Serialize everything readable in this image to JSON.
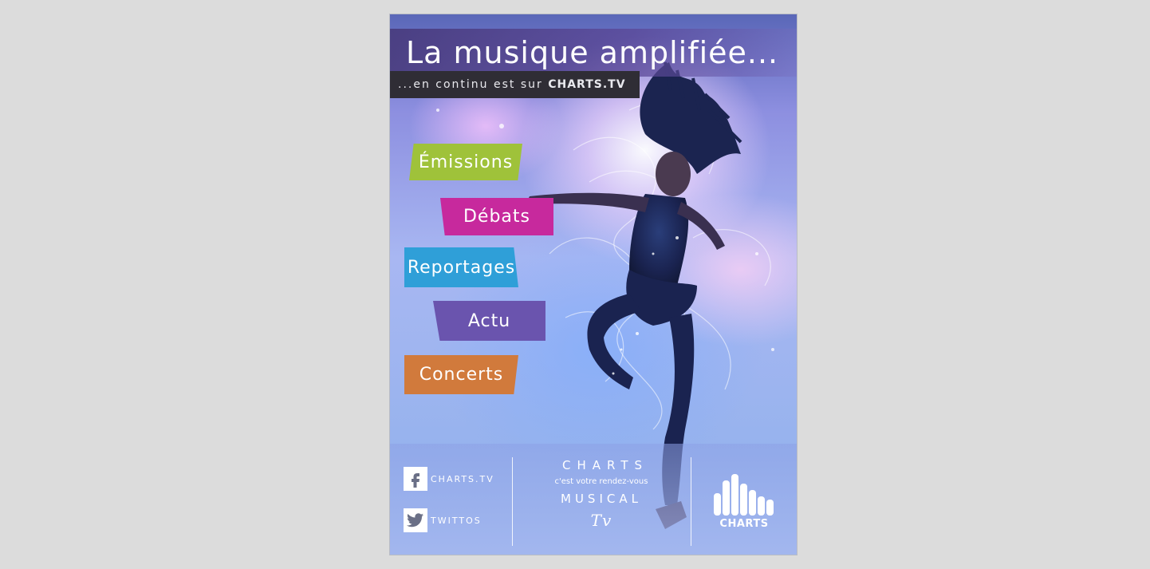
{
  "poster": {
    "title": "La musique amplifiée...",
    "subtitle_prefix": "...en continu est sur ",
    "subtitle_brand": "CHARTS.TV"
  },
  "tags": [
    {
      "label": "Émissions",
      "color": "#9fc23a"
    },
    {
      "label": "Débats",
      "color": "#c7299d"
    },
    {
      "label": "Reportages",
      "color": "#2f9fd8"
    },
    {
      "label": "Actu",
      "color": "#6a54ae"
    },
    {
      "label": "Concerts",
      "color": "#d17a3c"
    }
  ],
  "footer": {
    "facebook": {
      "icon": "facebook-icon",
      "label": "CHARTS.TV"
    },
    "twitter": {
      "icon": "twitter-bird-icon",
      "label": "TWITTOS"
    },
    "brand_name": "CHARTS",
    "tagline": "c'est votre rendez-vous",
    "musical": "MUSICAL",
    "tv": "Tv",
    "logo_text": "CHARTS"
  }
}
